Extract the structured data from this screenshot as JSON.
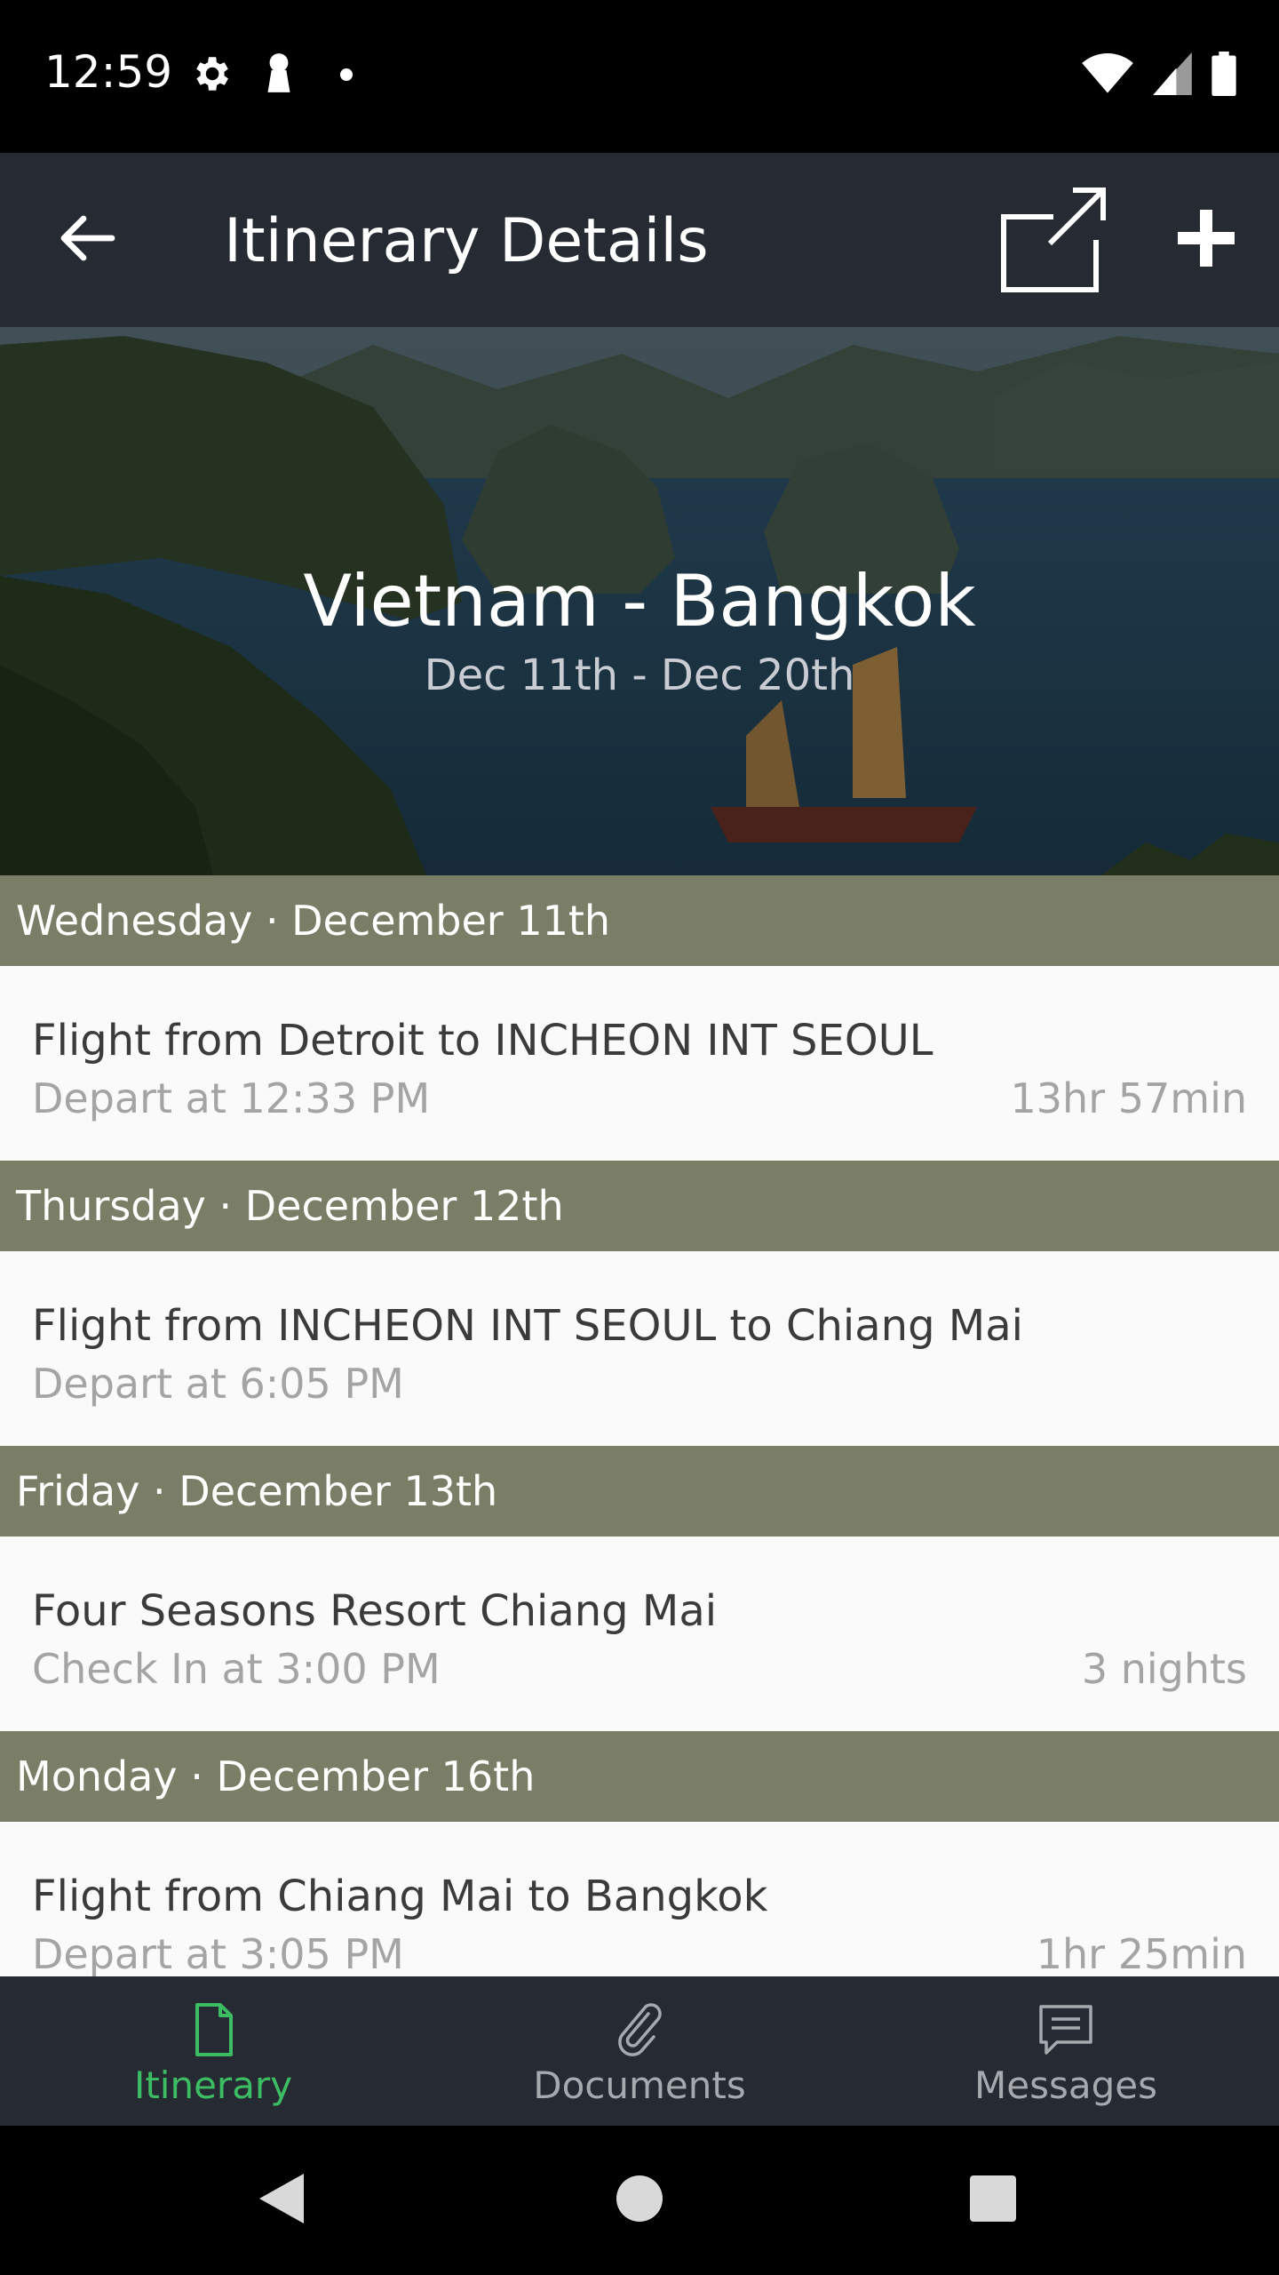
{
  "status_bar": {
    "time": "12:59",
    "icons_left": [
      "gear-icon",
      "keyhole-icon",
      "dot-icon"
    ],
    "icons_right": [
      "wifi-icon",
      "signal-icon",
      "battery-icon"
    ]
  },
  "app_bar": {
    "title": "Itinerary Details",
    "back_icon": "arrow-left-icon",
    "share_icon": "open-external-icon",
    "add_icon": "plus-icon"
  },
  "hero": {
    "title": "Vietnam -  Bangkok",
    "dates": "Dec 11th - Dec 20th"
  },
  "days": [
    {
      "header": "Wednesday · December 11th",
      "items": [
        {
          "title": "Flight from Detroit to INCHEON INT SEOUL",
          "subtitle": "Depart at 12:33 PM",
          "meta": "13hr 57min"
        }
      ]
    },
    {
      "header": "Thursday · December 12th",
      "items": [
        {
          "title": "Flight from INCHEON INT SEOUL to Chiang Mai",
          "subtitle": "Depart at 6:05 PM",
          "meta": ""
        }
      ]
    },
    {
      "header": "Friday · December 13th",
      "items": [
        {
          "title": "Four Seasons Resort Chiang Mai",
          "subtitle": "Check In at 3:00 PM",
          "meta": "3 nights"
        }
      ]
    },
    {
      "header": "Monday · December 16th",
      "items": [
        {
          "title": "Flight from Chiang Mai to Bangkok",
          "subtitle": "Depart at 3:05 PM",
          "meta": "1hr 25min"
        }
      ]
    }
  ],
  "bottom_nav": {
    "tabs": [
      {
        "label": "Itinerary",
        "icon": "document-icon",
        "active": true
      },
      {
        "label": "Documents",
        "icon": "paperclip-icon",
        "active": false
      },
      {
        "label": "Messages",
        "icon": "message-icon",
        "active": false
      }
    ]
  },
  "colors": {
    "app_bar": "#262a33",
    "day_header": "#7a7e66",
    "active_tab": "#3dbd63",
    "inactive_tab": "#a6a9ae"
  }
}
